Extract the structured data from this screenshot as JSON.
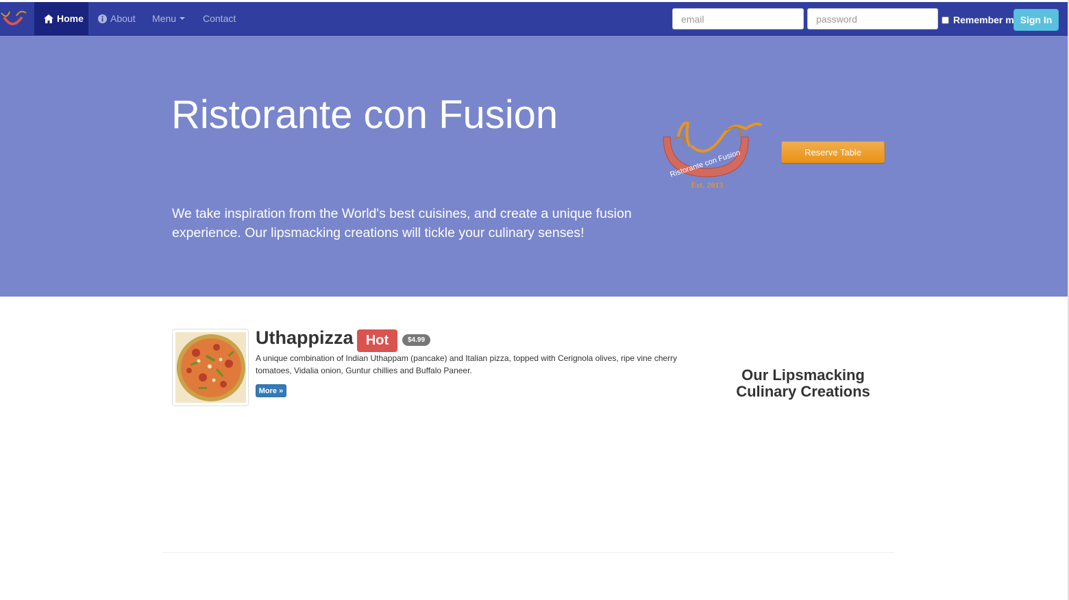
{
  "navbar": {
    "items": [
      {
        "label": "Home",
        "icon": "home-icon"
      },
      {
        "label": "About",
        "icon": "info-icon"
      },
      {
        "label": "Menu",
        "icon": "caret-down-icon"
      },
      {
        "label": "Contact",
        "icon": ""
      }
    ],
    "login": {
      "email_placeholder": "email",
      "password_placeholder": "password",
      "remember_label": "Remember me",
      "signin_label": "Sign In"
    }
  },
  "hero": {
    "title": "Ristorante con Fusion",
    "text": "We take inspiration from the World's best cuisines, and create a unique fusion experience. Our lipsmacking creations will tickle your culinary senses!",
    "logo_text": "Ristorante con Fusion",
    "logo_est": "Est. 2013",
    "reserve_label": "Reserve Table"
  },
  "dish": {
    "name": "Uthappizza",
    "badge": "Hot",
    "price": "$4.99",
    "description": "A unique combination of Indian Uthappam (pancake) and Italian pizza, topped with Cerignola olives, ripe vine cherry tomatoes, Vidalia onion, Guntur chillies and Buffalo Paneer.",
    "more_label": "More »"
  },
  "side_heading": "Our Lipsmacking Culinary Creations",
  "colors": {
    "navbar": "#303F9F",
    "navbar_active": "#1a237e",
    "jumbotron": "#7986CB",
    "reserve": "#f0ad4e",
    "signin": "#5bc0de",
    "hot_badge": "#d9534f",
    "more_button": "#337ab7"
  }
}
